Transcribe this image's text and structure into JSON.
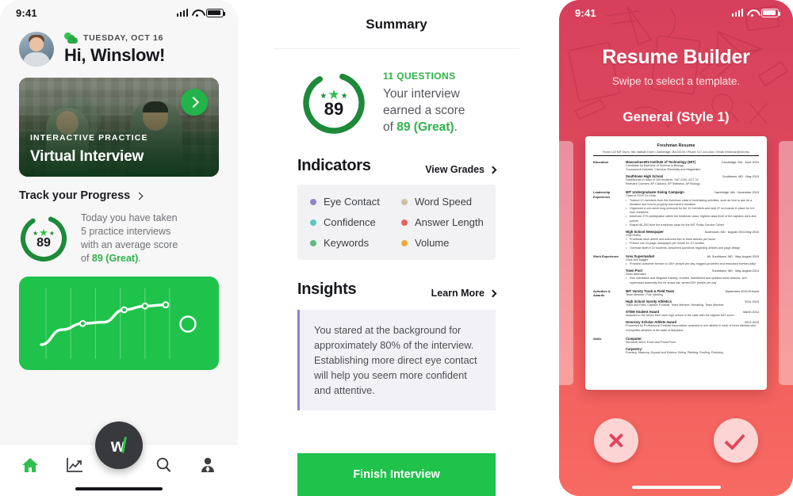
{
  "screen1": {
    "status": {
      "time": "9:41"
    },
    "header": {
      "date": "TUESDAY, OCT 16",
      "greeting": "Hi, Winslow!",
      "weather_icon": "sun-cloud-icon"
    },
    "hero": {
      "kicker": "INTERACTIVE PRACTICE",
      "title": "Virtual Interview",
      "play_icon": "chevron-right-icon"
    },
    "progress": {
      "section_title": "Track your Progress",
      "score": "89",
      "text_line1": "Today you have taken",
      "text_line2": "5 practice interviews",
      "text_line3": "with an average score",
      "text_line4_pre": "of ",
      "text_line4_hl": "89 (Great)",
      "text_line4_post": "."
    },
    "tabs": [
      {
        "name": "home",
        "icon": "home-icon",
        "active": true
      },
      {
        "name": "stats",
        "icon": "chart-line-icon",
        "active": false
      },
      {
        "name": "record",
        "icon": "w-logo-icon",
        "active": false
      },
      {
        "name": "search",
        "icon": "search-icon",
        "active": false
      },
      {
        "name": "profile",
        "icon": "person-tie-icon",
        "active": false
      }
    ],
    "chart_data": {
      "type": "line",
      "title": "Progress trend",
      "x": [
        0,
        1,
        2,
        3,
        4,
        5,
        6
      ],
      "values": [
        18,
        42,
        52,
        54,
        74,
        80,
        82
      ],
      "markers": [
        52,
        74,
        80,
        82
      ],
      "gridlines": 6,
      "line_color": "#ffffff",
      "background": "#1fc24a",
      "xlabel": "",
      "ylabel": "",
      "ylim": [
        0,
        100
      ]
    }
  },
  "screen2": {
    "header": {
      "title": "Summary"
    },
    "score": {
      "value": "89",
      "questions": "11 QUESTIONS",
      "line1": "Your interview",
      "line2": "earned a score",
      "line3_pre": "of ",
      "line3_hl": "89 (Great)",
      "line3_post": "."
    },
    "indicators": {
      "title": "Indicators",
      "link": "View Grades",
      "items": [
        {
          "label": "Eye Contact",
          "color": "#8d86c9"
        },
        {
          "label": "Word Speed",
          "color": "#cdc2a3"
        },
        {
          "label": "Confidence",
          "color": "#5ec6bd"
        },
        {
          "label": "Answer Length",
          "color": "#f0605f"
        },
        {
          "label": "Keywords",
          "color": "#5fba80"
        },
        {
          "label": "Volume",
          "color": "#f4a93d"
        }
      ]
    },
    "insights": {
      "title": "Insights",
      "link": "Learn More",
      "text": "You stared at the background for approximately 80% of the interview. Establishing more direct eye contact will help you seem more confident and attentive."
    },
    "finish_button": "Finish Interview"
  },
  "screen3": {
    "status": {
      "time": "9:41"
    },
    "title": "Resume Builder",
    "subtitle": "Swipe to select a template.",
    "style_label": "General (Style 1)",
    "actions": {
      "reject_icon": "close-x-icon",
      "accept_icon": "check-icon"
    },
    "resume": {
      "name": "Freshman Resume",
      "contact": "Room 122 MIT Dorm, 981 Institute Drive • Cambridge, MA 02139 • Phone: 617-xxx-xxxx • Email: freshman@mit.edu",
      "sections": [
        {
          "label": "Education",
          "entries": [
            {
              "org": "Massachusetts Institute of Technology (MIT)",
              "loc": "Cambridge, MA",
              "date": "June 2019",
              "details": [
                "Candidate for Bachelor of Science in Biology",
                "Coursework includes: Calculus, Electricity and Magnetism"
              ],
              "bullets": []
            },
            {
              "org": "Southtown High School",
              "loc": "Southtown, MD",
              "date": "May 2015",
              "details": [
                "Salutatorian in class of 326 students, SAT 2240, ACT 33",
                "Relevant Courses: AP Calculus, AP Statistics, AP Biology"
              ],
              "bullets": []
            }
          ]
        },
        {
          "label": "Leadership Experience",
          "entries": [
            {
              "org": "MIT Undergraduate Giving Campaign",
              "loc": "Cambridge, MA",
              "date": "November 2015",
              "details": [
                "Class of 2019 Co-Chair"
              ],
              "bullets": [
                "Trained 12 members from the freshman class in fundraising activities, such as how to ask for a donation and how to properly document a donation",
                "Organized a one-week long schedule for the 12 members and kept 47 on-boards in place for 4-5 hour durations",
                "Achieved 37% participation within the freshman class, highest class level of the captains wins and juniors",
                "Raised $1,253 from the freshman class for the MIT Public Service Center"
              ]
            },
            {
              "org": "High School Newspaper",
              "loc": "Southtown, MD",
              "date": "August 2014-May 2015",
              "details": [
                "Chief Editor"
              ],
              "bullets": [
                "Proofread each article and authored two to three articles per issue",
                "Printed one 24-page newspaper per month for 10 months",
                "Oversaw staff of 15 students. Answered questions regarding articles and page design"
              ]
            }
          ]
        },
        {
          "label": "Work Experience",
          "entries": [
            {
              "org": "Area Supermarket",
              "loc": "Mt. Southtown, MD",
              "date": "May-August 2015",
              "details": [
                "Clerk and bagger"
              ],
              "bullets": [
                "Provided customer service to 150+ people per day, bagged groceries and restocked shelves daily"
              ]
            },
            {
              "org": "Town Pool",
              "loc": "Southtown, MD",
              "date": "May-August 2014",
              "details": [
                "Swim Attendant"
              ],
              "bullets": [
                "Ran orientation and lifeguard training, created, maintained and updated swim lessons, and supervised assembly line for snack bar: served 50+ people per day"
              ]
            }
          ]
        },
        {
          "label": "Activities & Awards",
          "entries": [
            {
              "org": "MIT Varsity Track & Field Team",
              "loc": "September 2015-Present",
              "date": "",
              "details": [
                "Team Member, Pole Vaulting"
              ],
              "bullets": []
            },
            {
              "org": "High School Varsity Athletics",
              "loc": "2011-2015",
              "date": "",
              "details": [
                "Track and Field, Captain; Football, Team Member; Wrestling, Team Member"
              ],
              "bullets": []
            },
            {
              "org": "STEM Student Award",
              "loc": "March 2014",
              "date": "",
              "details": [
                "Awarded to the senior from each high school in the state with the highest SAT score"
              ],
              "bullets": []
            },
            {
              "org": "Honorary Scholar Athlete Award",
              "loc": "2013-2015",
              "date": "",
              "details": [
                "Presented by Professional Football Association: awarded to one athlete in each of three districts who exemplifies athletics in the state of Maryland"
              ],
              "bullets": []
            }
          ]
        },
        {
          "label": "Skills",
          "entries": [
            {
              "org": "Computer:",
              "loc": "",
              "date": "",
              "details": [
                "Microsoft Word, Excel and PowerPoint"
              ],
              "bullets": []
            },
            {
              "org": "Carpentry:",
              "loc": "",
              "date": "",
              "details": [
                "Framing, Masonry, Drywall and Exterior Siding, Painting, Roofing, Finishing"
              ],
              "bullets": []
            }
          ]
        }
      ]
    }
  }
}
